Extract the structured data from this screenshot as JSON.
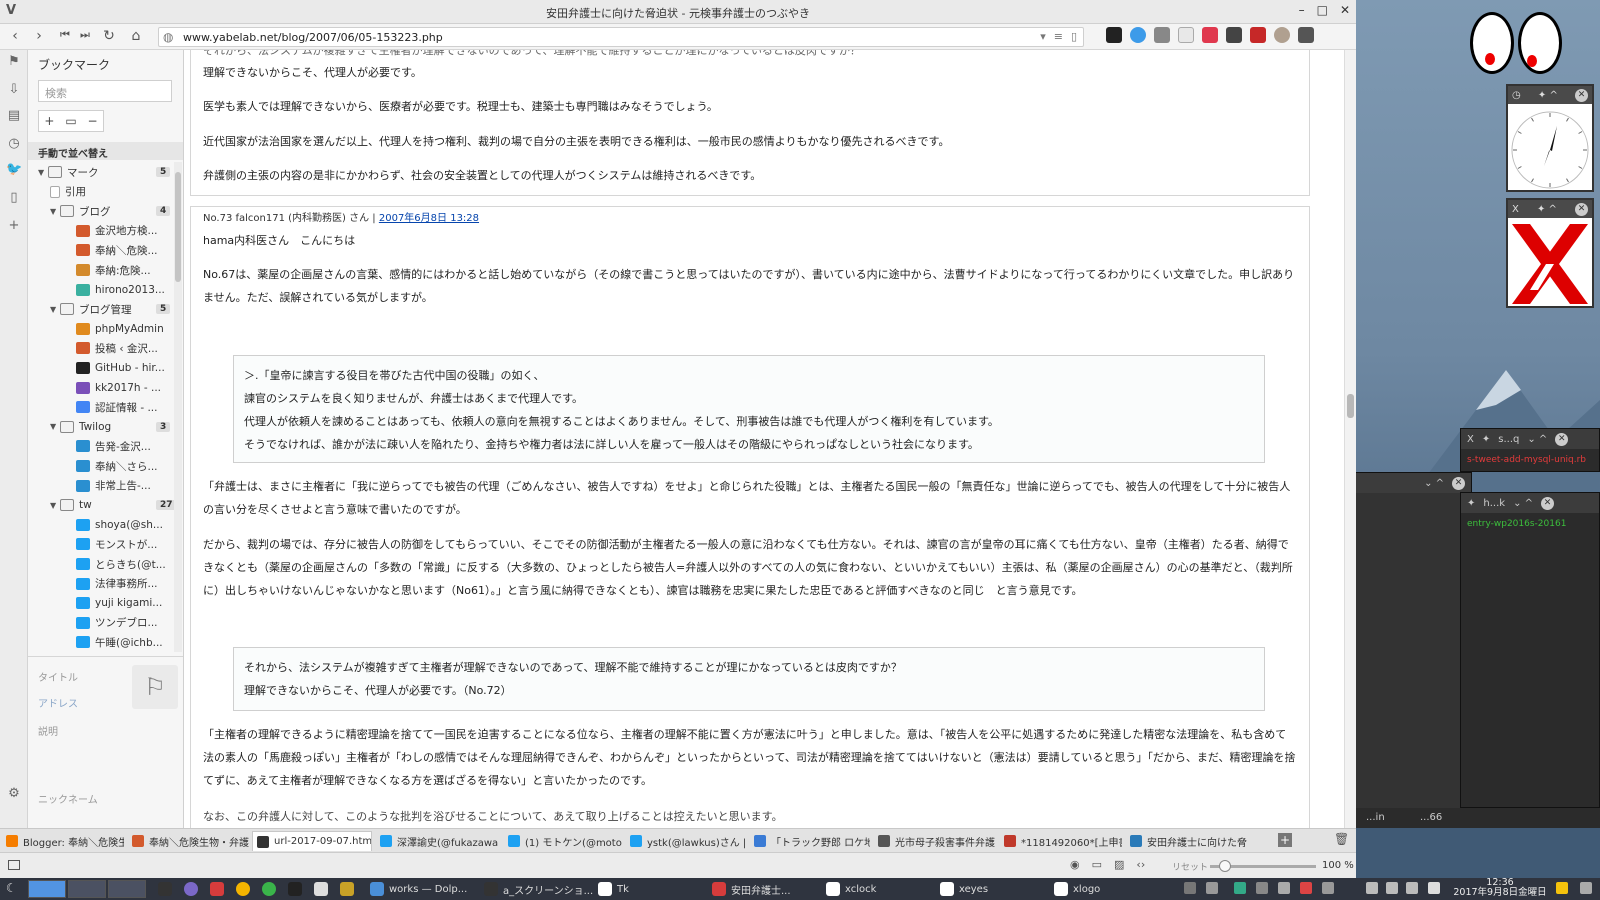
{
  "window": {
    "title": "安田弁護士に向けた脅迫状 - 元検事弁護士のつぶやき",
    "logo": "V"
  },
  "navbar": {
    "url": "www.yabelab.net/blog/2007/06/05-153223.php"
  },
  "bookmarks": {
    "header": "ブックマーク",
    "search_placeholder": "検索",
    "sort_label": "手動で並べ替え",
    "tree": [
      {
        "label": "マーク",
        "type": "folder",
        "count": "5",
        "depth": 1
      },
      {
        "label": "引用",
        "type": "page",
        "depth": 2
      },
      {
        "label": "ブログ",
        "type": "folder",
        "count": "4",
        "depth": 2
      },
      {
        "label": "金沢地方検...",
        "type": "link",
        "depth": 3,
        "color": "#d35a2d"
      },
      {
        "label": "奉納＼危険...",
        "type": "link",
        "depth": 3,
        "color": "#d35a2d"
      },
      {
        "label": "奉納:危険...",
        "type": "link",
        "depth": 3,
        "color": "#d38a2d"
      },
      {
        "label": "hirono2013...",
        "type": "link",
        "depth": 3,
        "color": "#3ab0a0"
      },
      {
        "label": "ブログ管理",
        "type": "folder",
        "count": "5",
        "depth": 2
      },
      {
        "label": "phpMyAdmin",
        "type": "link",
        "depth": 3,
        "color": "#e08a1e"
      },
      {
        "label": "投稿 ‹ 金沢...",
        "type": "link",
        "depth": 3,
        "color": "#d35a2d"
      },
      {
        "label": "GitHub - hir...",
        "type": "link",
        "depth": 3,
        "color": "#222222"
      },
      {
        "label": "kk2017h - ...",
        "type": "link",
        "depth": 3,
        "color": "#7a4fb8"
      },
      {
        "label": "認証情報 - ...",
        "type": "link",
        "depth": 3,
        "color": "#4285f4"
      },
      {
        "label": "Twilog",
        "type": "folder",
        "count": "3",
        "depth": 2
      },
      {
        "label": "告発-金沢...",
        "type": "link",
        "depth": 3,
        "color": "#2a8fd0"
      },
      {
        "label": "奉納＼さら...",
        "type": "link",
        "depth": 3,
        "color": "#2a8fd0"
      },
      {
        "label": "非常上告-...",
        "type": "link",
        "depth": 3,
        "color": "#2a8fd0"
      },
      {
        "label": "tw",
        "type": "folder",
        "count": "27",
        "depth": 2
      },
      {
        "label": "shoya(@sh...",
        "type": "link",
        "depth": 3,
        "color": "#1da1f2"
      },
      {
        "label": "モンストが...",
        "type": "link",
        "depth": 3,
        "color": "#1da1f2"
      },
      {
        "label": "とらきち(@t...",
        "type": "link",
        "depth": 3,
        "color": "#1da1f2"
      },
      {
        "label": "法律事務所...",
        "type": "link",
        "depth": 3,
        "color": "#1da1f2"
      },
      {
        "label": "yuji kigami...",
        "type": "link",
        "depth": 3,
        "color": "#1da1f2"
      },
      {
        "label": "ツンデブロ...",
        "type": "link",
        "depth": 3,
        "color": "#1da1f2"
      },
      {
        "label": "午睡(@ichb...",
        "type": "link",
        "depth": 3,
        "color": "#1da1f2"
      }
    ],
    "detail": {
      "title_label": "タイトル",
      "address_label": "アドレス",
      "desc_label": "説明",
      "nick_label": "ニックネーム"
    }
  },
  "content": {
    "prev_comment": {
      "cut_line": "それから、法システムが複雑すぎて主権者が理解できないのであって、理解不能で維持することが理にかなっているとは皮肉ですか？",
      "paragraphs": [
        "理解できないからこそ、代理人が必要です。",
        "医学も素人では理解できないから、医療者が必要です。税理士も、建築士も専門職はみなそうでしょう。",
        "近代国家が法治国家を選んだ以上、代理人を持つ権利、裁判の場で自分の主張を表明できる権利は、一般市民の感情よりもかなり優先されるべきです。",
        "弁護側の主張の内容の是非にかかわらず、社会の安全装置としての代理人がつくシステムは維持されるべきです。"
      ]
    },
    "comment": {
      "meta_prefix": "No.73 falcon171 (内科勤務医) さん | ",
      "meta_date": "2007年6月8日 13:28",
      "greeting": "hama内科医さん　こんにちは",
      "p1": "No.67は、薬屋の企画屋さんの言葉、感情的にはわかると話し始めていながら（その線で書こうと思ってはいたのですが）、書いている内に途中から、法曹サイドよりになって行ってるわかりにくい文章でした。申し訳ありません。ただ、誤解されている気がしますが。",
      "quote1": [
        "＞.「皇帝に諫言する役目を帯びた古代中国の役職」の如く、",
        "諫官のシステムを良く知りませんが、弁護士はあくまで代理人です。",
        "代理人が依頼人を諫めることはあっても、依頼人の意向を無視することはよくありません。そして、刑事被告は誰でも代理人がつく権利を有しています。",
        "そうでなければ、誰かが法に疎い人を陥れたり、金持ちや権力者は法に詳しい人を雇って一般人はその階級にやられっぱなしという社会になります。"
      ],
      "p2": "「弁護士は、まさに主権者に「我に逆らってでも被告の代理（ごめんなさい、被告人ですね）をせよ」と命じられた役職」とは、主権者たる国民一般の「無責任な」世論に逆らってでも、被告人の代理をして十分に被告人の言い分を尽くさせよと言う意味で書いたのですが。",
      "p3": "だから、裁判の場では、存分に被告人の防御をしてもらっていい、そこでその防御活動が主権者たる一般人の意に沿わなくても仕方ない。それは、諫官の言が皇帝の耳に痛くても仕方ない、皇帝（主権者）たる者、納得できなくとも（薬屋の企画屋さんの「多数の「常識」に反する（大多数の、ひょっとしたら被告人=弁護人以外のすべての人の気に食わない、といいかえてもいい）主張は、私（薬屋の企画屋さん）の心の基準だと、（裁判所に）出しちゃいけないんじゃないかなと思います（No61）。」と言う風に納得できなくとも）、諫官は職務を忠実に果たした忠臣であると評価すべきなのと同じ　と言う意見です。",
      "quote2": [
        "それから、法システムが複雑すぎて主権者が理解できないのであって、理解不能で維持することが理にかなっているとは皮肉ですか？",
        "理解できないからこそ、代理人が必要です。（No.72）"
      ],
      "p4": "「主権者の理解できるように精密理論を捨てて一国民を迫害することになる位なら、主権者の理解不能に置く方が憲法に叶う」と申しました。意は、「被告人を公平に処遇するために発達した精密な法理論を、私も含めて法の素人の「馬鹿殺っぽい」主権者が「わしの感情ではそんな理屈納得できんぞ、わからんぞ」といったからといって、司法が精密理論を捨ててはいけないと（憲法は）要請していると思う」「だから、まだ、精密理論を捨てずに、あえて主権者が理解できなくなる方を選ばざるを得ない」と言いたかったのです。",
      "p5_cut": "なお、この弁護人に対して、このような批判を浴びせることについて、あえて取り上げることは控えたいと思います。"
    }
  },
  "tabs": [
    {
      "label": "Blogger: 奉納＼危険生",
      "color": "#f57d00"
    },
    {
      "label": "奉納＼危険生物・弁護",
      "color": "#d35a2d"
    },
    {
      "label": "url-2017-09-07.html",
      "color": "#333333",
      "active": true
    },
    {
      "label": "深澤諭史(@fukazawa",
      "color": "#1da1f2"
    },
    {
      "label": "(1) モトケン(@motoke",
      "color": "#1da1f2"
    },
    {
      "label": "ystk(@lawkus)さん | T",
      "color": "#1da1f2"
    },
    {
      "label": "「トラック野郎 ロケ地研",
      "color": "#3a7bd5"
    },
    {
      "label": "光市母子殺害事件弁護",
      "color": "#555555"
    },
    {
      "label": "*1181492060*[上申書",
      "color": "#c0392b"
    },
    {
      "label": "安田弁護士に向けた脅",
      "color": "#2a7ab8"
    }
  ],
  "statusbar": {
    "reset_label": "リセット",
    "zoom": "100 %",
    "zoom_value": 0.15
  },
  "desktop": {
    "term1_title": "s...q",
    "term1_text": "s-tweet-add-mysql-uniq.rb",
    "term2_title": "h...k",
    "term2_text": "entry-wp2016s-20161",
    "mini1": "...in",
    "mini2": "...66"
  },
  "taskbar": {
    "items": [
      {
        "label": "works — Dolp..."
      },
      {
        "label": "a_スクリーンショ..."
      },
      {
        "label": "Tk"
      },
      {
        "label": "安田弁護士..."
      },
      {
        "label": "xclock"
      },
      {
        "label": "xeyes"
      },
      {
        "label": "xlogo"
      }
    ],
    "clock_time": "12:36",
    "clock_date": "2017年9月8日金曜日"
  }
}
